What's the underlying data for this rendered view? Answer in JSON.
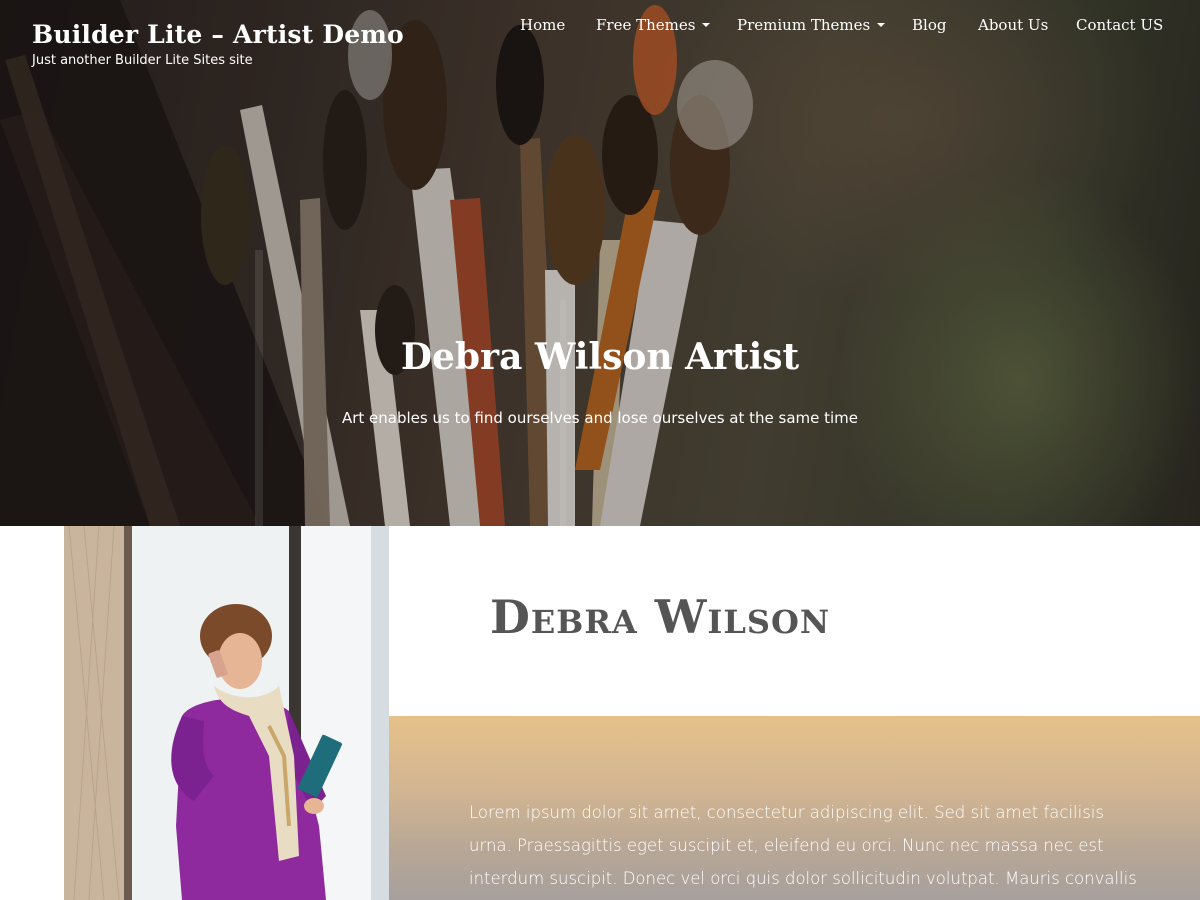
{
  "site": {
    "title": "Builder Lite – Artist Demo",
    "tagline": "Just another Builder Lite Sites site"
  },
  "nav": {
    "items": [
      {
        "label": "Home",
        "has_dropdown": false
      },
      {
        "label": "Free Themes",
        "has_dropdown": true
      },
      {
        "label": "Premium Themes",
        "has_dropdown": true
      },
      {
        "label": "Blog",
        "has_dropdown": false
      },
      {
        "label": "About Us",
        "has_dropdown": false
      },
      {
        "label": "Contact US",
        "has_dropdown": false
      }
    ]
  },
  "hero": {
    "heading": "Debra Wilson Artist",
    "subheading": "Art enables us to find ourselves and lose ourselves at the same time"
  },
  "about": {
    "name": "Debra Wilson",
    "bio": "Lorem ipsum dolor sit amet, consectetur adipiscing elit. Sed sit amet facilisis urna. Praessagittis eget suscipit et, eleifend eu orci. Nunc nec massa nec est interdum suscipit. Donec vel orci quis dolor sollicitudin volutpat. Mauris convallis"
  },
  "colors": {
    "hero_overlay_text": "#ffffff",
    "name_heading": "#555555",
    "bio_gradient_top": "#e6c189",
    "bio_gradient_bottom": "#a7a09d",
    "dress": "#8e2a9e"
  }
}
